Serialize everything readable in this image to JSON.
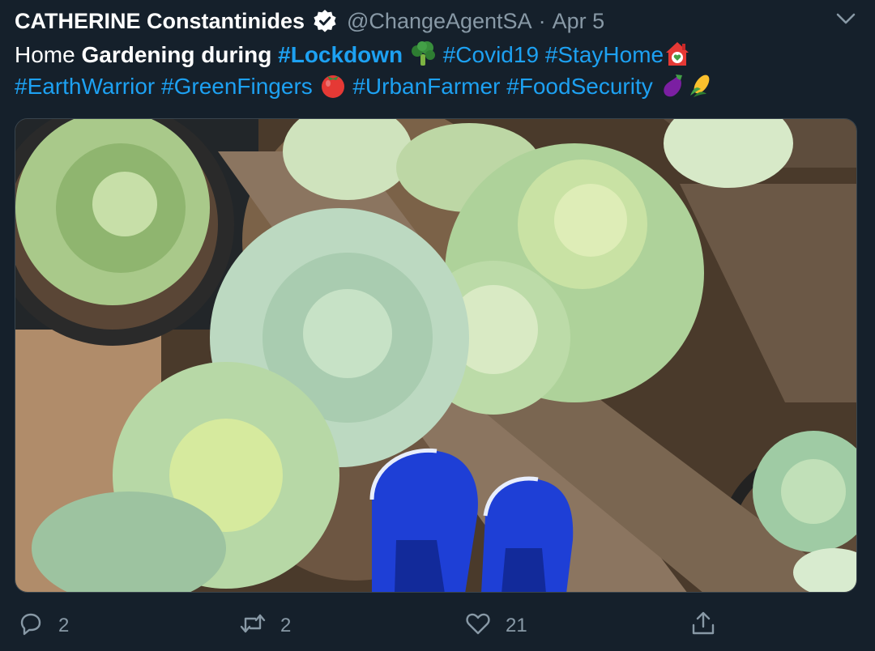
{
  "tweet": {
    "author": {
      "name": "CATHERINE Constantinides",
      "handle": "@ChangeAgentSA",
      "verified": true
    },
    "separator": "·",
    "date": "Apr 5",
    "text": {
      "home": "Home ",
      "gardening": "Gardening during ",
      "lockdown": "#Lockdown",
      "covid": "#Covid19",
      "stayhome": "#StayHome",
      "earthwarrior": "#EarthWarrior",
      "greenfingers": "#GreenFingers",
      "urbanfarmer": "#UrbanFarmer",
      "foodsecurity": "#FoodSecurity"
    },
    "emojis": [
      "broccoli",
      "house-with-heart",
      "tomato",
      "eggplant",
      "corn"
    ],
    "media": {
      "icons": [
        "cabbage-plants",
        "wooden-pallet",
        "blue-sneakers"
      ]
    },
    "actions": {
      "reply_count": "2",
      "retweet_count": "2",
      "like_count": "21"
    }
  },
  "colors": {
    "background": "#15202b",
    "text": "#ffffff",
    "secondary": "#8899a6",
    "link": "#1da1f2",
    "border": "#38444d"
  }
}
